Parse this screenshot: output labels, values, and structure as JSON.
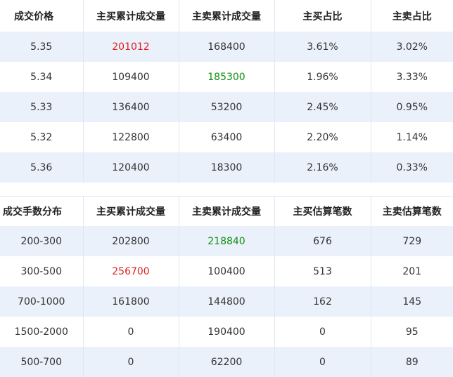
{
  "colors": {
    "up": "#e02020",
    "down": "#109010",
    "stripe": "#eaf1fb"
  },
  "price_table": {
    "headers": [
      "成交价格",
      "主买累计成交量",
      "主卖累计成交量",
      "主买占比",
      "主卖占比"
    ],
    "rows": [
      [
        "5.35",
        "201012",
        "168400",
        "3.61%",
        "3.02%"
      ],
      [
        "5.34",
        "109400",
        "185300",
        "1.96%",
        "3.33%"
      ],
      [
        "5.33",
        "136400",
        "53200",
        "2.45%",
        "0.95%"
      ],
      [
        "5.32",
        "122800",
        "63400",
        "2.20%",
        "1.14%"
      ],
      [
        "5.36",
        "120400",
        "18300",
        "2.16%",
        "0.33%"
      ]
    ]
  },
  "lot_table": {
    "headers": [
      "成交手数分布",
      "主买累计成交量",
      "主卖累计成交量",
      "主买估算笔数",
      "主卖估算笔数"
    ],
    "rows": [
      [
        "200-300",
        "202800",
        "218840",
        "676",
        "729"
      ],
      [
        "300-500",
        "256700",
        "100400",
        "513",
        "201"
      ],
      [
        "700-1000",
        "161800",
        "144800",
        "162",
        "145"
      ],
      [
        "1500-2000",
        "0",
        "190400",
        "0",
        "95"
      ],
      [
        "500-700",
        "0",
        "62200",
        "0",
        "89"
      ]
    ]
  }
}
